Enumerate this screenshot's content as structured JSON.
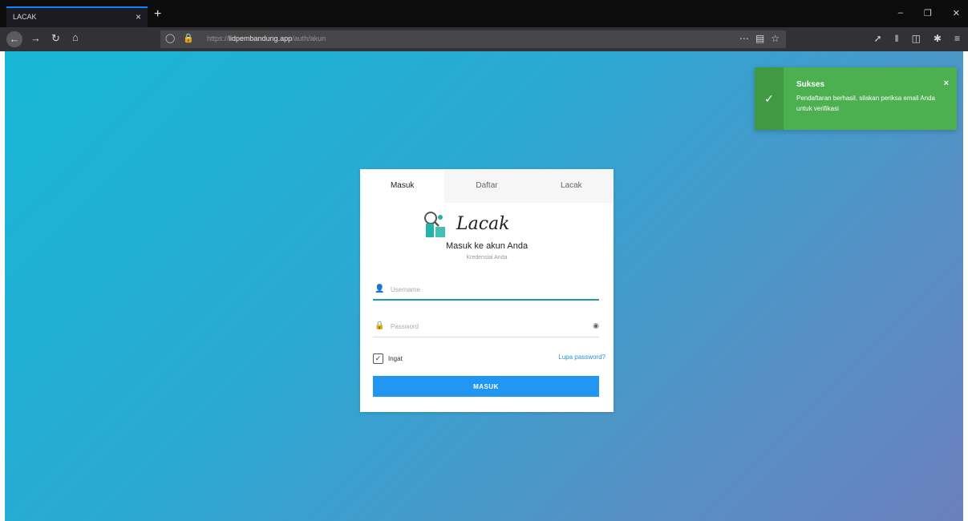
{
  "browser": {
    "tab_title": "LACAK",
    "tab_close": "×",
    "new_tab": "+",
    "url_prefix": "https://",
    "url_host": "lidpembandung.app",
    "url_path": "/auth/akun",
    "window_controls": {
      "minimize": "–",
      "restore": "❐",
      "close": "✕"
    }
  },
  "toast": {
    "title": "Sukses",
    "message": "Pendaftaran berhasil, silakan periksa email Anda untuk verifikasi",
    "close": "×",
    "color": "#4caf50"
  },
  "login": {
    "tabs": [
      "Masuk",
      "Daftar",
      "Lacak"
    ],
    "logo_text": "Lacak",
    "title": "Masuk ke akun Anda",
    "subtitle": "Kredensial Anda",
    "username_placeholder": "Username",
    "password_placeholder": "Password",
    "remember_label": "Ingat",
    "forgot_label": "Lupa password?",
    "submit_label": "MASUK",
    "accent_color": "#2196f3"
  }
}
